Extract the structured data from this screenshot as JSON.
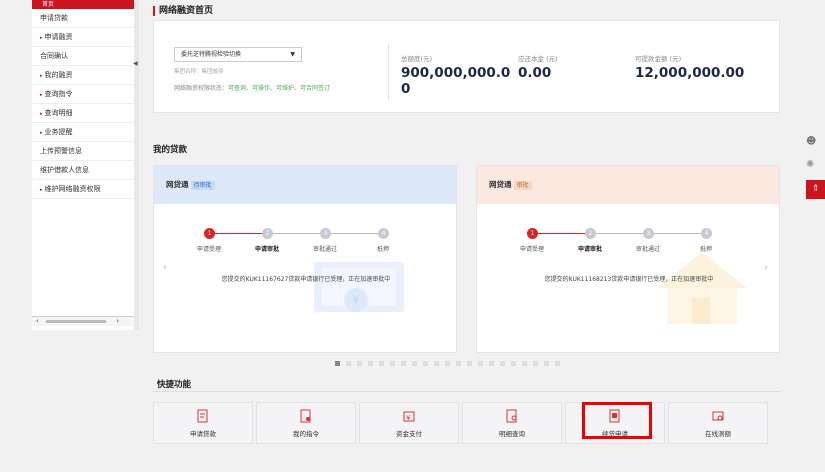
{
  "sidebar": {
    "active_label": "首页",
    "items": [
      {
        "label": "申请贷款",
        "arrow": false
      },
      {
        "label": "申请融资",
        "arrow": true
      },
      {
        "label": "合同确认",
        "arrow": false
      },
      {
        "label": "我的融资",
        "arrow": true
      },
      {
        "label": "查询指令",
        "arrow": true
      },
      {
        "label": "查询明细",
        "arrow": true
      },
      {
        "label": "业务提醒",
        "arrow": true
      },
      {
        "label": "上传预警信息",
        "arrow": false
      },
      {
        "label": "维护借款人信息",
        "arrow": false
      },
      {
        "label": "维护网络融资权限",
        "arrow": true
      }
    ]
  },
  "header": {
    "title": "网络融资首页"
  },
  "summary": {
    "select_value": "委托芝特腾视检验切换",
    "group_name_line": "集团名称：集团融资",
    "permission_label": "网络融资权限状态：",
    "permission_value": "可查询、可操作、可维护、可合同签订",
    "stats": [
      {
        "label": "总额度(元)",
        "value_line1": "900,000,000.0",
        "value_line2": "0"
      },
      {
        "label": "应还本金 (元)",
        "value_line1": "0.00",
        "value_line2": ""
      },
      {
        "label": "可提款金额 (元)",
        "value_line1": "12,000,000.00",
        "value_line2": ""
      }
    ]
  },
  "loans_title": "我的贷款",
  "loans": [
    {
      "product": "网贷通",
      "status": "待审批",
      "steps": [
        "申请受理",
        "申请审批",
        "审批通过",
        "抵押"
      ],
      "step_numbers": [
        "1",
        "2",
        "3",
        "4"
      ],
      "message": "您提交的KUK11167627贷款申请银行已受理，正在加速审批中"
    },
    {
      "product": "网贷通",
      "status": "审批",
      "steps": [
        "申请受理",
        "申请审批",
        "审批通过",
        "抵押"
      ],
      "step_numbers": [
        "1",
        "2",
        "3",
        "4"
      ],
      "message": "您提交的KUK11168213贷款申请银行已受理，正在加速审批中"
    }
  ],
  "quick_title": "快捷功能",
  "quick": [
    {
      "label": "申请贷款"
    },
    {
      "label": "我的指令"
    },
    {
      "label": "资金支付"
    },
    {
      "label": "明细查询"
    },
    {
      "label": "续贷申请"
    },
    {
      "label": "在线测额"
    }
  ],
  "colors": {
    "brand_red": "#c9151e",
    "blue_head": "#dde8f8",
    "orange_head": "#fbe9e0"
  }
}
